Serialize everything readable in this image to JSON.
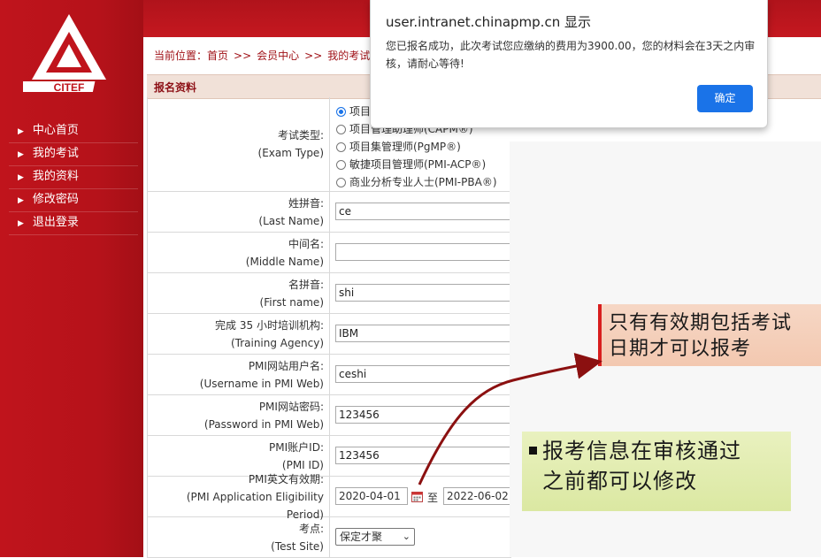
{
  "logo_text": "CITEF",
  "nav": {
    "items": [
      {
        "label": "中心首页"
      },
      {
        "label": "我的考试"
      },
      {
        "label": "我的资料"
      },
      {
        "label": "修改密码"
      },
      {
        "label": "退出登录"
      }
    ]
  },
  "breadcrumb": {
    "prefix": "当前位置：",
    "items": [
      "首页",
      "会员中心",
      "我的考试"
    ],
    "separator": ">>"
  },
  "section_title": "报名资料",
  "form": {
    "exam_type": {
      "label_cn": "考试类型:",
      "label_en": "(Exam Type)",
      "options": [
        {
          "label": "项目",
          "checked": true
        },
        {
          "label": "项目管理助理师(CAPM®)",
          "checked": false
        },
        {
          "label": "项目集管理师(PgMP®)",
          "checked": false
        },
        {
          "label": "敏捷项目管理师(PMI-ACP®)",
          "checked": false
        },
        {
          "label": "商业分析专业人士(PMI-PBA®)",
          "checked": false
        }
      ]
    },
    "last_name": {
      "label_cn": "姓拼音:",
      "label_en": "(Last Name)",
      "value": "ce"
    },
    "middle_name": {
      "label_cn": "中间名:",
      "label_en": "(Middle Name)",
      "value": ""
    },
    "first_name": {
      "label_cn": "名拼音:",
      "label_en": "(First name)",
      "value": "shi"
    },
    "training_agency": {
      "label_cn": "完成 35 小时培训机构:",
      "label_en": "(Training Agency)",
      "value": "IBM"
    },
    "pmi_username": {
      "label_cn": "PMI网站用户名:",
      "label_en": "(Username in PMI Web)",
      "value": "ceshi"
    },
    "pmi_password": {
      "label_cn": "PMI网站密码:",
      "label_en": "(Password in PMI Web)",
      "value": "123456"
    },
    "pmi_id": {
      "label_cn": "PMI账户ID:",
      "label_en": "(PMI ID)",
      "value": "123456"
    },
    "eligibility": {
      "label_cn": "PMI英文有效期:",
      "label_en": "(PMI Application Eligibility Period)",
      "start": "2020-04-01",
      "to": "至",
      "end": "2022-06-02"
    },
    "test_site": {
      "label_cn": "考点:",
      "label_en": "(Test Site)",
      "value": "保定才聚"
    }
  },
  "dialog": {
    "title": "user.intranet.chinapmp.cn 显示",
    "message": "您已报名成功，此次考试您应缴纳的费用为3900.00，您的材料会在3天之内审核，请耐心等待!",
    "confirm_label": "确定",
    "button_color": "#1a73e8"
  },
  "annotations": {
    "note1": [
      "只有有效期包括考试",
      "日期才可以报考"
    ],
    "note2": [
      "报考信息在审核通过",
      "之前都可以修改"
    ]
  },
  "colors": {
    "sidebar_red": "#c0141c",
    "accent_red": "#d81e1e"
  }
}
